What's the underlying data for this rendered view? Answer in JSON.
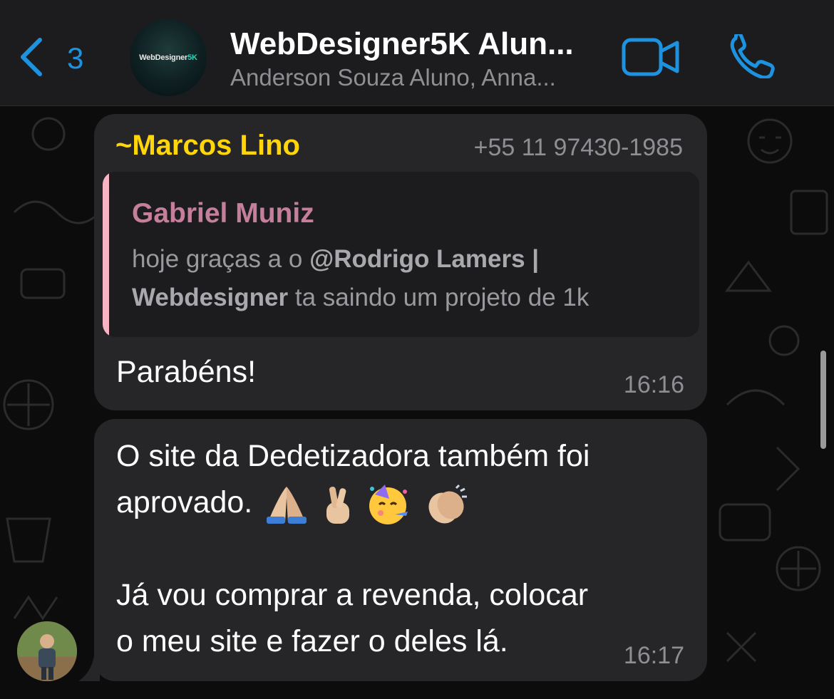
{
  "header": {
    "back_count": "3",
    "group_title": "WebDesigner5K Alun...",
    "group_subtitle": "Anderson Souza Aluno, Anna...",
    "avatar_logo_main": "WebDesigner",
    "avatar_logo_accent": "5K",
    "icons": {
      "back": "chevron-left-icon",
      "video": "video-camera-icon",
      "call": "phone-icon"
    },
    "accent_color": "#1d93e0"
  },
  "messages": [
    {
      "sender_name": "Marcos Lino",
      "sender_prefix": "~",
      "sender_phone": "+55 11 97430-1985",
      "sender_color": "#ffd60a",
      "quote": {
        "author": "Gabriel Muniz",
        "text_before": "hoje graças a o ",
        "mention": "@Rodrigo Lamers | Webdesigner",
        "text_after": " ta saindo um projeto de 1k",
        "line1_plain": "hoje graças a o ",
        "line1_bold": "@Rodrigo Lamers |",
        "line2_bold": "Webdesigner",
        "line2_plain": " ta saindo um projeto de 1k"
      },
      "text": "Parabéns!",
      "time": "16:16"
    },
    {
      "lines": [
        "O site da Dedetizadora também foi",
        "aprovado.",
        "",
        "Já vou comprar a revenda, colocar",
        "o meu site e fazer o deles lá."
      ],
      "emojis": [
        "folded-hands",
        "crossed-fingers",
        "partying-face",
        "clapping-hands"
      ],
      "time": "16:17"
    }
  ]
}
